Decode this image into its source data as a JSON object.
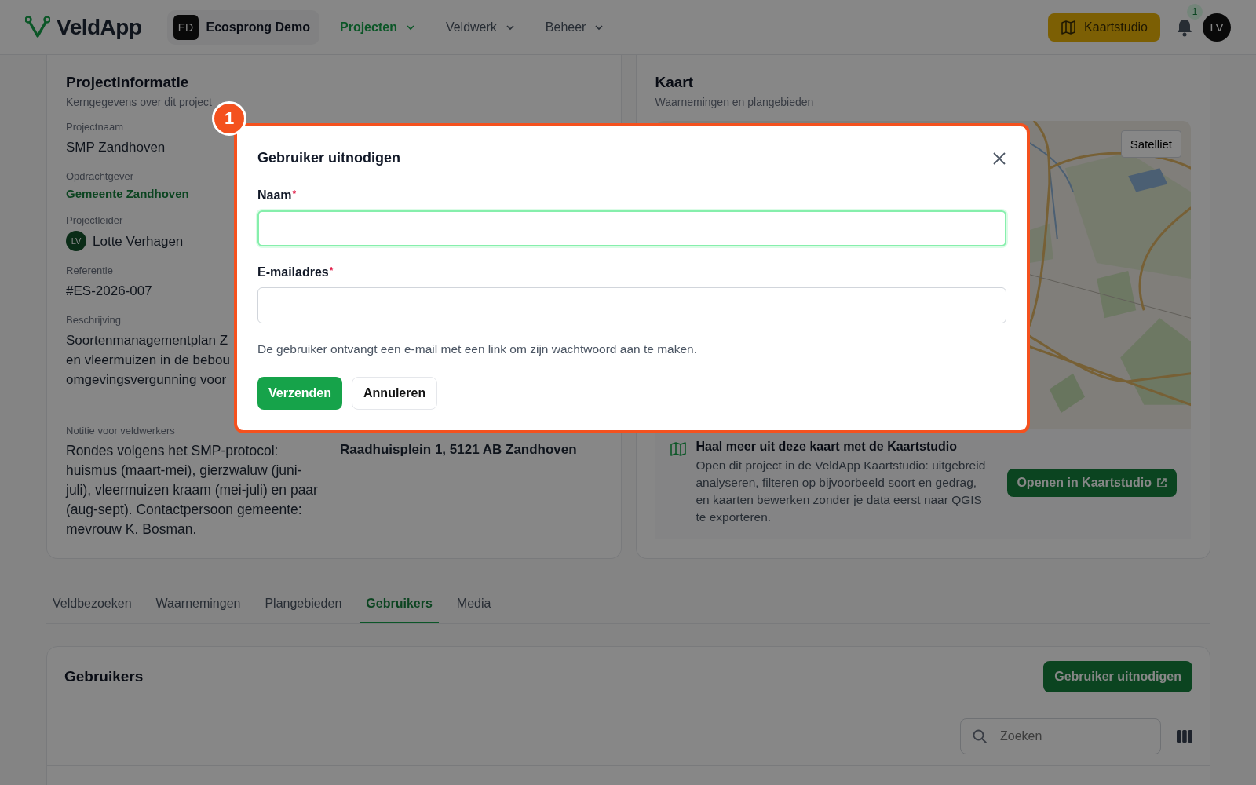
{
  "header": {
    "logo": "VeldApp",
    "workspace": {
      "initials": "ED",
      "name": "Ecosprong Demo"
    },
    "nav": [
      {
        "label": "Projecten",
        "selected": true
      },
      {
        "label": "Veldwerk",
        "selected": false
      },
      {
        "label": "Beheer",
        "selected": false
      }
    ],
    "studio_button": "Kaartstudio",
    "notifications": "1",
    "avatar": "LV"
  },
  "project_info": {
    "title": "Projectinformatie",
    "subtitle": "Kerngegevens over dit project",
    "fields": [
      {
        "label": "Projectnaam",
        "value": "SMP Zandhoven",
        "kind": "text"
      },
      {
        "label": "Opdrachtgever",
        "value": "Gemeente Zandhoven",
        "kind": "link"
      },
      {
        "label": "Projectleider",
        "value": "Lotte Verhagen",
        "initials": "LV",
        "kind": "person"
      },
      {
        "label": "Referentie",
        "value": "#ES-2026-007",
        "kind": "text"
      }
    ],
    "description": {
      "label": "Beschrijving",
      "lines": [
        "Soortenmanagementplan Z",
        "en vleermuizen in de bebou",
        "omgevingsvergunning voor"
      ]
    },
    "note": {
      "label": "Notitie voor veldwerkers",
      "text": "Rondes volgens het SMP-protocol: huismus (maart-mei), gierzwaluw (juni-juli), vleermuizen kraam (mei-juli) en paar (aug-sept). Contactpersoon gemeente: mevrouw K. Bosman."
    },
    "address": "Raadhuisplein 1, 5121 AB Zandhoven"
  },
  "map_card": {
    "title": "Kaart",
    "subtitle": "Waarnemingen en plangebieden",
    "map_toggle": "Satelliet",
    "promo": {
      "title": "Haal meer uit deze kaart met de Kaartstudio",
      "text": "Open dit project in de VeldApp Kaartstudio: uitgebreid analyseren, filteren op bijvoorbeeld soort en gedrag, en kaarten bewerken zonder je data eerst naar QGIS te exporteren.",
      "button": "Openen in Kaartstudio"
    }
  },
  "tabs": [
    {
      "label": "Veldbezoeken",
      "selected": false
    },
    {
      "label": "Waarnemingen",
      "selected": false
    },
    {
      "label": "Plangebieden",
      "selected": false
    },
    {
      "label": "Gebruikers",
      "selected": true
    },
    {
      "label": "Media",
      "selected": false
    }
  ],
  "users": {
    "title": "Gebruikers",
    "invite_button": "Gebruiker uitnodigen",
    "search_placeholder": "Zoeken"
  },
  "dialog": {
    "badge": "1",
    "title": "Gebruiker uitnodigen",
    "fields": [
      {
        "label": "Naam",
        "required_mark": "*",
        "focused": true
      },
      {
        "label": "E-mailadres",
        "required_mark": "*",
        "focused": false
      }
    ],
    "hint": "De gebruiker ontvangt een e-mail met een link om zijn wachtwoord aan te maken.",
    "submit": "Verzenden",
    "cancel": "Annuleren"
  }
}
